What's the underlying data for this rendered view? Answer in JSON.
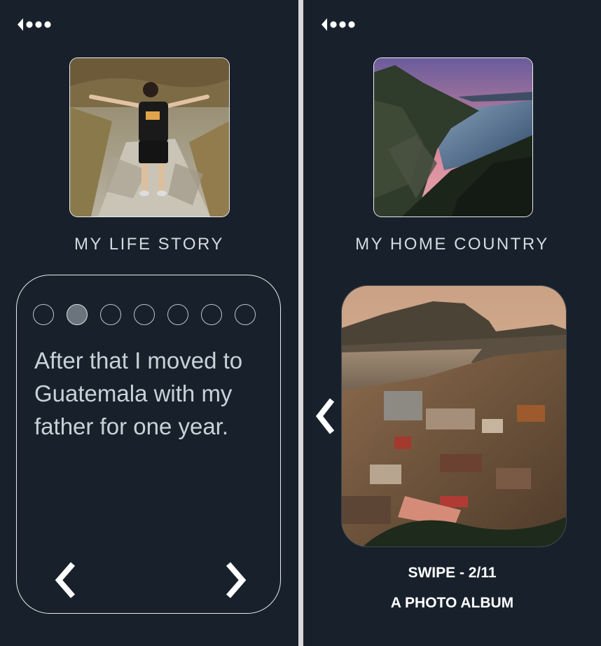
{
  "left_screen": {
    "caption": "MY LIFE STORY",
    "thumbnail_icon": "photo-man-on-rocks",
    "dots": [
      {
        "active": false
      },
      {
        "active": true
      },
      {
        "active": false
      },
      {
        "active": false
      },
      {
        "active": false
      },
      {
        "active": false
      },
      {
        "active": false
      }
    ],
    "story_text": "After that I moved to Guatemala with my father for one year."
  },
  "right_screen": {
    "caption": "MY HOME COUNTRY",
    "thumbnail_icon": "photo-fjord-sunset",
    "album_photo_icon": "photo-coastal-town",
    "swipe_counter": "SWIPE - 2/11",
    "album_title": "A PHOTO ALBUM"
  },
  "colors": {
    "background": "#18212b",
    "divider": "#d8d8d8",
    "text_light": "#d3dae1",
    "active_dot": "#6b737c"
  }
}
